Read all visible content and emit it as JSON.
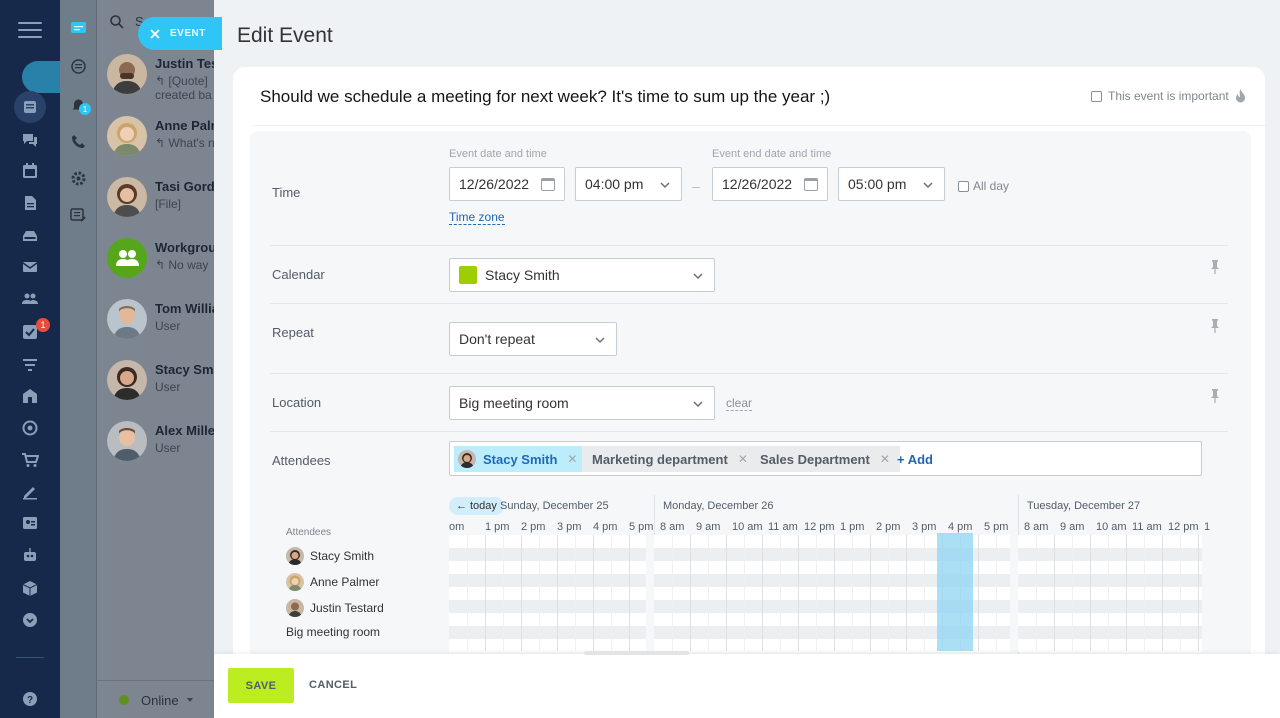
{
  "rail": {
    "badge_count": "1",
    "icons": [
      "menu-icon",
      "feed-icon",
      "chat-icon",
      "calendar-icon",
      "document-icon",
      "drive-icon",
      "mail-icon",
      "group-icon",
      "tasks-icon",
      "crm-icon",
      "sites-icon",
      "goal-icon",
      "shop-icon",
      "signature-icon",
      "contact-icon",
      "robot-icon",
      "box-icon",
      "more-icon",
      "help-icon"
    ]
  },
  "strip": {
    "badge_count": "1"
  },
  "chats": {
    "search_partial": "S",
    "items": [
      {
        "name": "Justin Tes",
        "line1": "↰ [Quote]",
        "line2": "created ba"
      },
      {
        "name": "Anne Palm",
        "line1": "↰ What's n",
        "line2": ""
      },
      {
        "name": "Tasi Gordo",
        "line1": "[File]",
        "line2": ""
      },
      {
        "name": "Workgroup",
        "line1": "↰ No way",
        "line2": ""
      },
      {
        "name": "Tom Willia",
        "line1": "User",
        "line2": ""
      },
      {
        "name": "Stacy Smi",
        "line1": "User",
        "line2": ""
      },
      {
        "name": "Alex Miller",
        "line1": "User",
        "line2": ""
      }
    ],
    "status": "Online"
  },
  "event_tab": {
    "label": "EVENT"
  },
  "panel": {
    "title": "Edit Event",
    "event_name": "Should we schedule a meeting for next week? It's time to sum up the year ;)",
    "important_label": "This event is important",
    "time": {
      "label": "Time",
      "start_caption": "Event date and time",
      "end_caption": "Event end date and time",
      "start_date": "12/26/2022",
      "start_time": "04:00 pm",
      "end_date": "12/26/2022",
      "end_time": "05:00 pm",
      "all_day_label": "All day",
      "timezone_link": "Time zone"
    },
    "calendar": {
      "label": "Calendar",
      "value": "Stacy Smith",
      "color": "#9dcf00"
    },
    "repeat": {
      "label": "Repeat",
      "value": "Don't repeat"
    },
    "location": {
      "label": "Location",
      "value": "Big meeting room",
      "clear_link": "clear"
    },
    "attendees": {
      "label": "Attendees",
      "tags": [
        "Stacy Smith",
        "Marketing department",
        "Sales Department"
      ],
      "add_link": "+ Add"
    },
    "planner": {
      "today_label": "today",
      "caption": "Attendees",
      "people": [
        "Stacy Smith",
        "Anne Palmer",
        "Justin Testard",
        "Big meeting room"
      ],
      "days": [
        "Sunday, December 25",
        "Monday, December 26",
        "Tuesday, December 27"
      ],
      "hours_day1": [
        "om",
        "1 pm",
        "2 pm",
        "3 pm",
        "4 pm",
        "5 pm"
      ],
      "hours_day2": [
        "8 am",
        "9 am",
        "10 am",
        "11 am",
        "12 pm",
        "1 pm",
        "2 pm",
        "3 pm",
        "4 pm",
        "5 pm"
      ],
      "hours_day3": [
        "8 am",
        "9 am",
        "10 am",
        "11 am",
        "12 pm",
        "1"
      ]
    }
  },
  "footer": {
    "save_label": "SAVE",
    "cancel_label": "CANCEL"
  },
  "colors": {
    "accent": "#2fc6f6",
    "save": "#bbed21",
    "link": "#2067b0",
    "badge": "#e74c3c"
  }
}
